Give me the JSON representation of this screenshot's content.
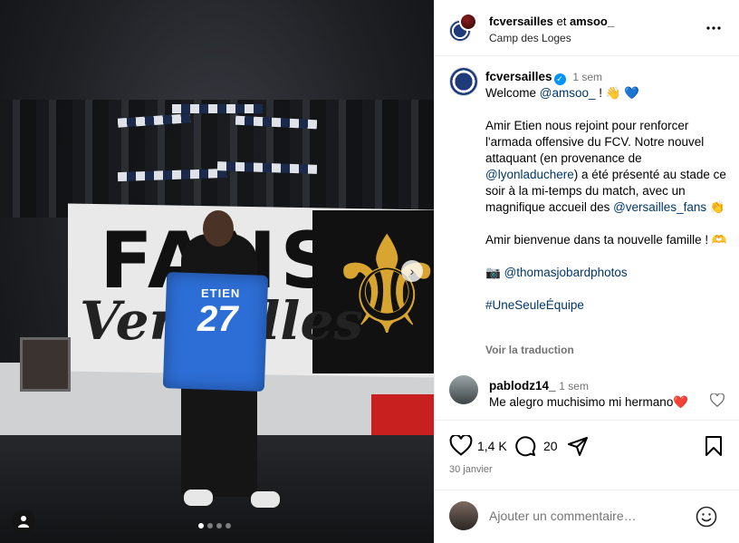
{
  "post": {
    "carousel": {
      "slide_count": 4,
      "active_index": 0
    },
    "jersey": {
      "name": "ETIEN",
      "number": "27"
    },
    "banner_text": {
      "line1": "FANS",
      "line2": "Versailles"
    }
  },
  "header": {
    "account": "fcversailles",
    "connector": "et",
    "collaborator": "amsoo_",
    "location": "Camp des Loges"
  },
  "caption": {
    "account": "fcversailles",
    "time": "1 sem",
    "p1_text": "Welcome ",
    "p1_mention": "@amsoo_",
    "p1_tail": " ! 👋 💙",
    "p2_a": "Amir Etien nous rejoint pour renforcer l'armada offensive du FCV. Notre nouvel attaquant (en provenance de ",
    "p2_mention1": "@lyonladuchere",
    "p2_b": ") a été présenté au stade ce soir à la mi-temps du match, avec un magnifique accueil des ",
    "p2_mention2": "@versailles_fans",
    "p2_c": " 👏",
    "p3": "Amir bienvenue dans ta nouvelle famille ! 🫶",
    "p4_icon": "📷",
    "p4_mention": "@thomasjobardphotos",
    "hashtag": "#UneSeuleÉquipe",
    "translate": "Voir la traduction"
  },
  "comment": {
    "user": "pablodz14_",
    "time": "1 sem",
    "text": "Me alegro muchisimo mi hermano",
    "emoji": "❤️"
  },
  "actions": {
    "likes": "1,4 K",
    "comments": "20"
  },
  "date": "30 janvier",
  "comment_input": {
    "placeholder": "Ajouter un commentaire…"
  }
}
